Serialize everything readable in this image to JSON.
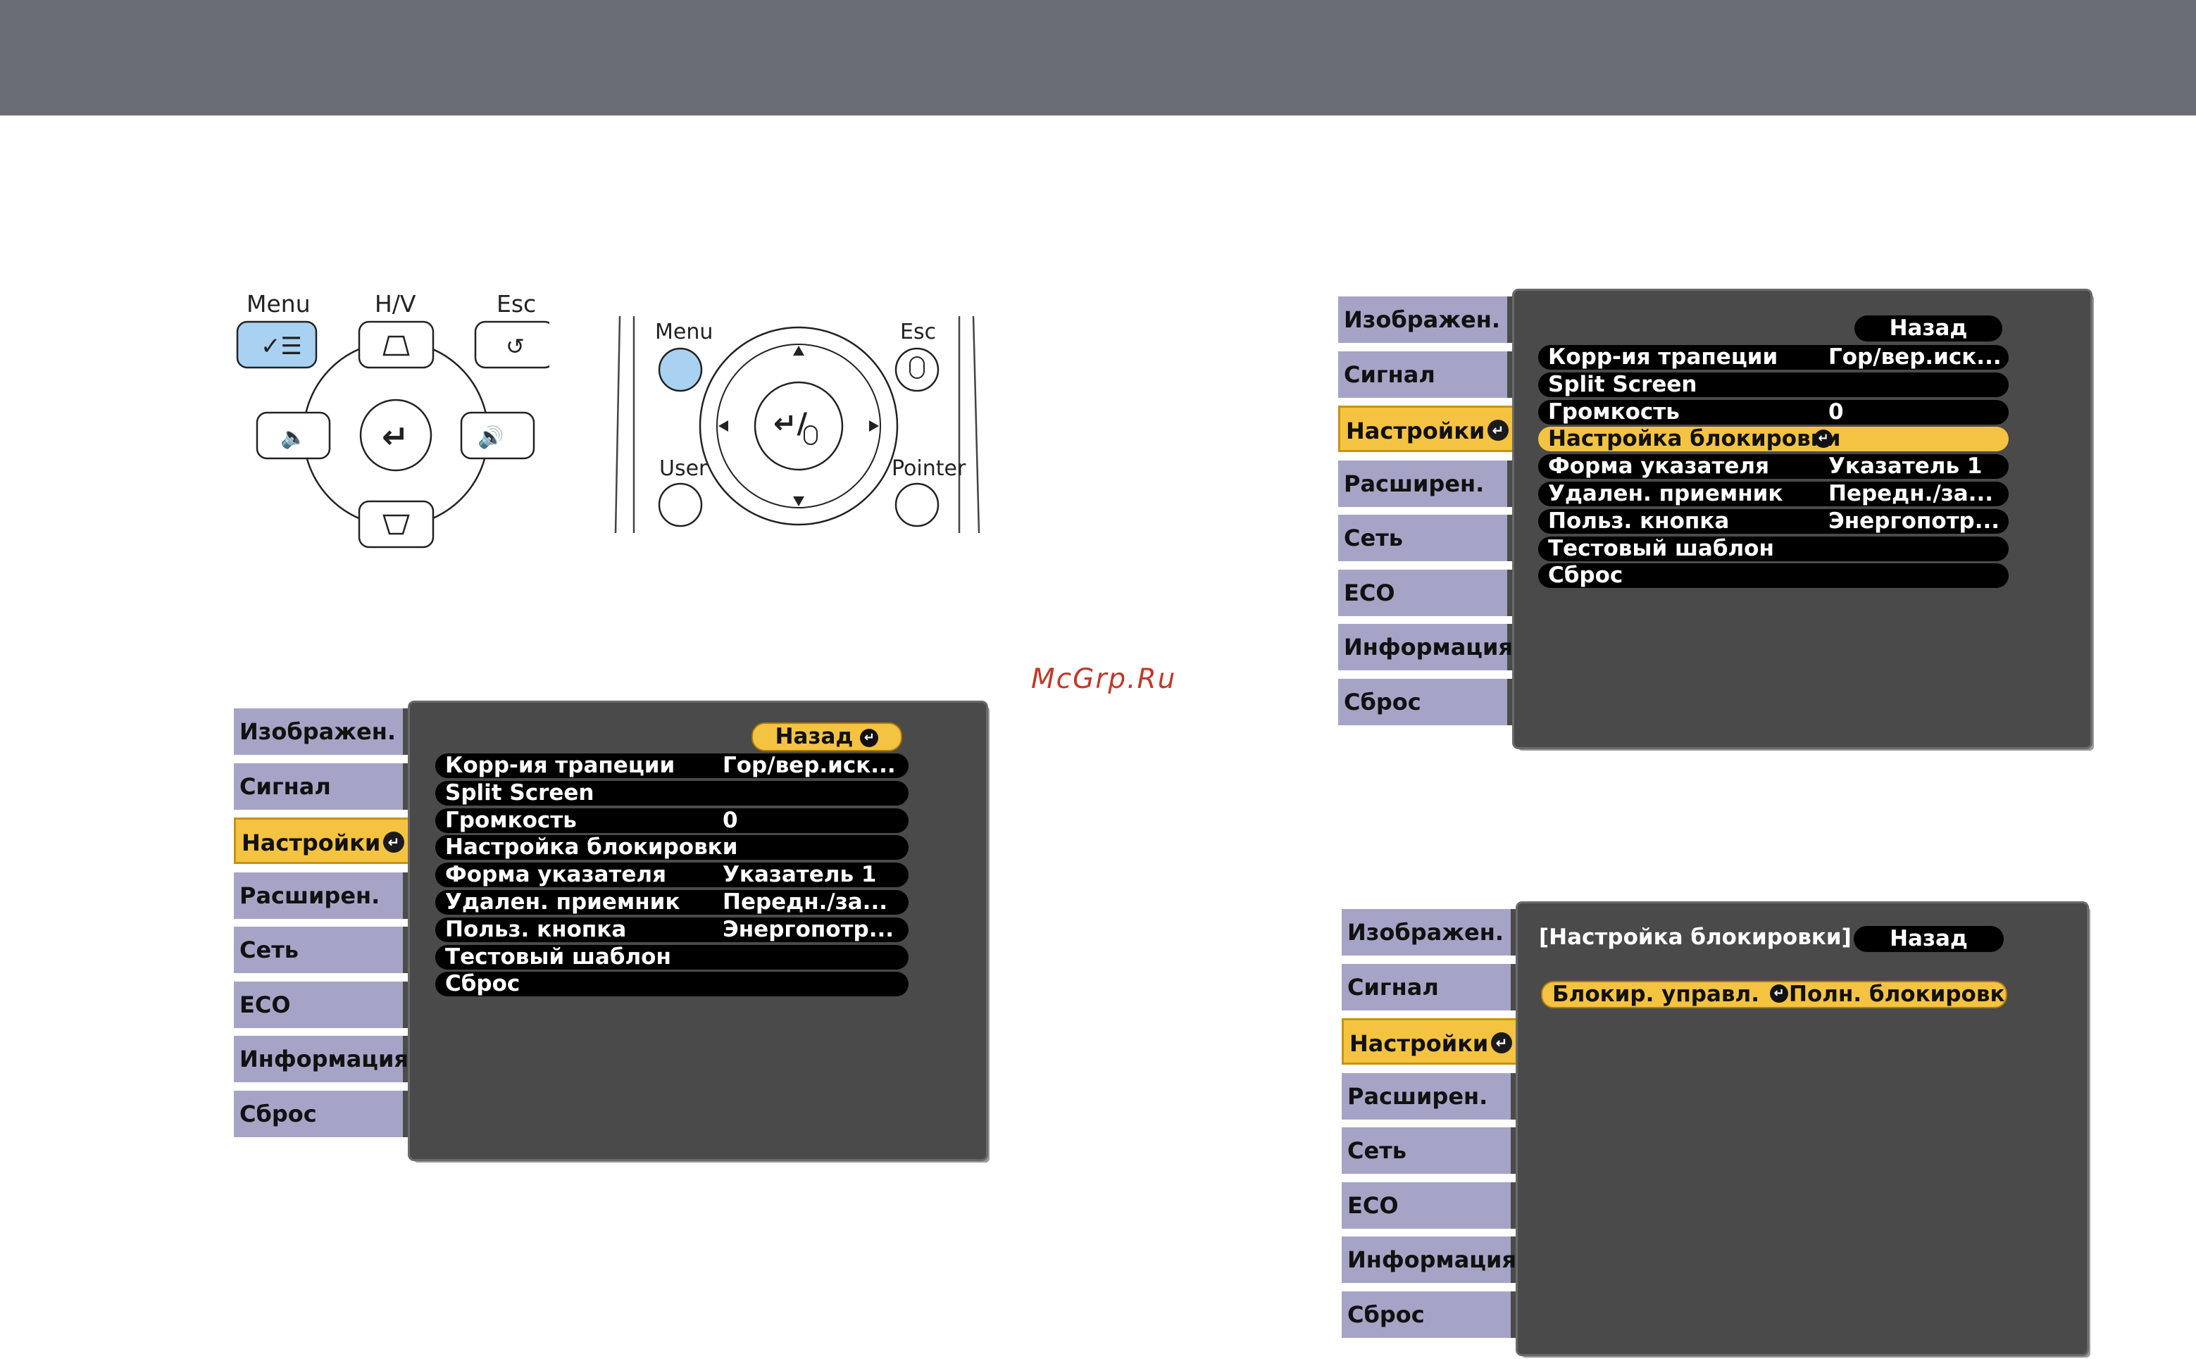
{
  "watermark": "McGrp.Ru",
  "remote1": {
    "menu_label": "Menu",
    "hv_label": "H/V",
    "esc_label": "Esc"
  },
  "remote2": {
    "menu_label": "Menu",
    "esc_label": "Esc",
    "user_label": "User",
    "pointer_label": "Pointer"
  },
  "tabs": [
    "Изображен.",
    "Сигнал",
    "Настройки",
    "Расширен.",
    "Сеть",
    "ECO",
    "Информация",
    "Сброс"
  ],
  "active_tab_index": 2,
  "enter_glyph": "↵",
  "menu_screen_1": {
    "back_label": "Назад",
    "rows": [
      {
        "label": "Корр-ия трапеции",
        "value": "Гор/вер.иск..."
      },
      {
        "label": "Split Screen",
        "value": ""
      },
      {
        "label": "Громкость",
        "value": "0"
      },
      {
        "label": "Настройка блокировки",
        "value": ""
      },
      {
        "label": "Форма указателя",
        "value": "Указатель 1"
      },
      {
        "label": "Удален. приемник",
        "value": "Передн./за..."
      },
      {
        "label": "Польз. кнопка",
        "value": "Энергопотр..."
      },
      {
        "label": "Тестовый шаблон",
        "value": ""
      },
      {
        "label": "Сброс",
        "value": ""
      }
    ]
  },
  "menu_screen_2": {
    "back_label": "Назад",
    "highlighted_row_index": 3,
    "rows": [
      {
        "label": "Корр-ия трапеции",
        "value": "Гор/вер.иск..."
      },
      {
        "label": "Split Screen",
        "value": ""
      },
      {
        "label": "Громкость",
        "value": "0"
      },
      {
        "label": "Настройка блокировки",
        "value": ""
      },
      {
        "label": "Форма указателя",
        "value": "Указатель 1"
      },
      {
        "label": "Удален. приемник",
        "value": "Передн./за..."
      },
      {
        "label": "Польз. кнопка",
        "value": "Энергопотр..."
      },
      {
        "label": "Тестовый шаблон",
        "value": ""
      },
      {
        "label": "Сброс",
        "value": ""
      }
    ]
  },
  "menu_screen_3": {
    "header": "[Настройка блокировки]",
    "back_label": "Назад",
    "rows": [
      {
        "label": "Блокир. управл.",
        "value": "Полн. блокировка"
      }
    ]
  },
  "colors": {
    "topbar": "#6a6d76",
    "tab": "#a6a4c6",
    "highlight": "#f5c342",
    "panel": "#4a4a4a",
    "watermark": "#c0392b",
    "menu_button": "#a9d2f2"
  }
}
